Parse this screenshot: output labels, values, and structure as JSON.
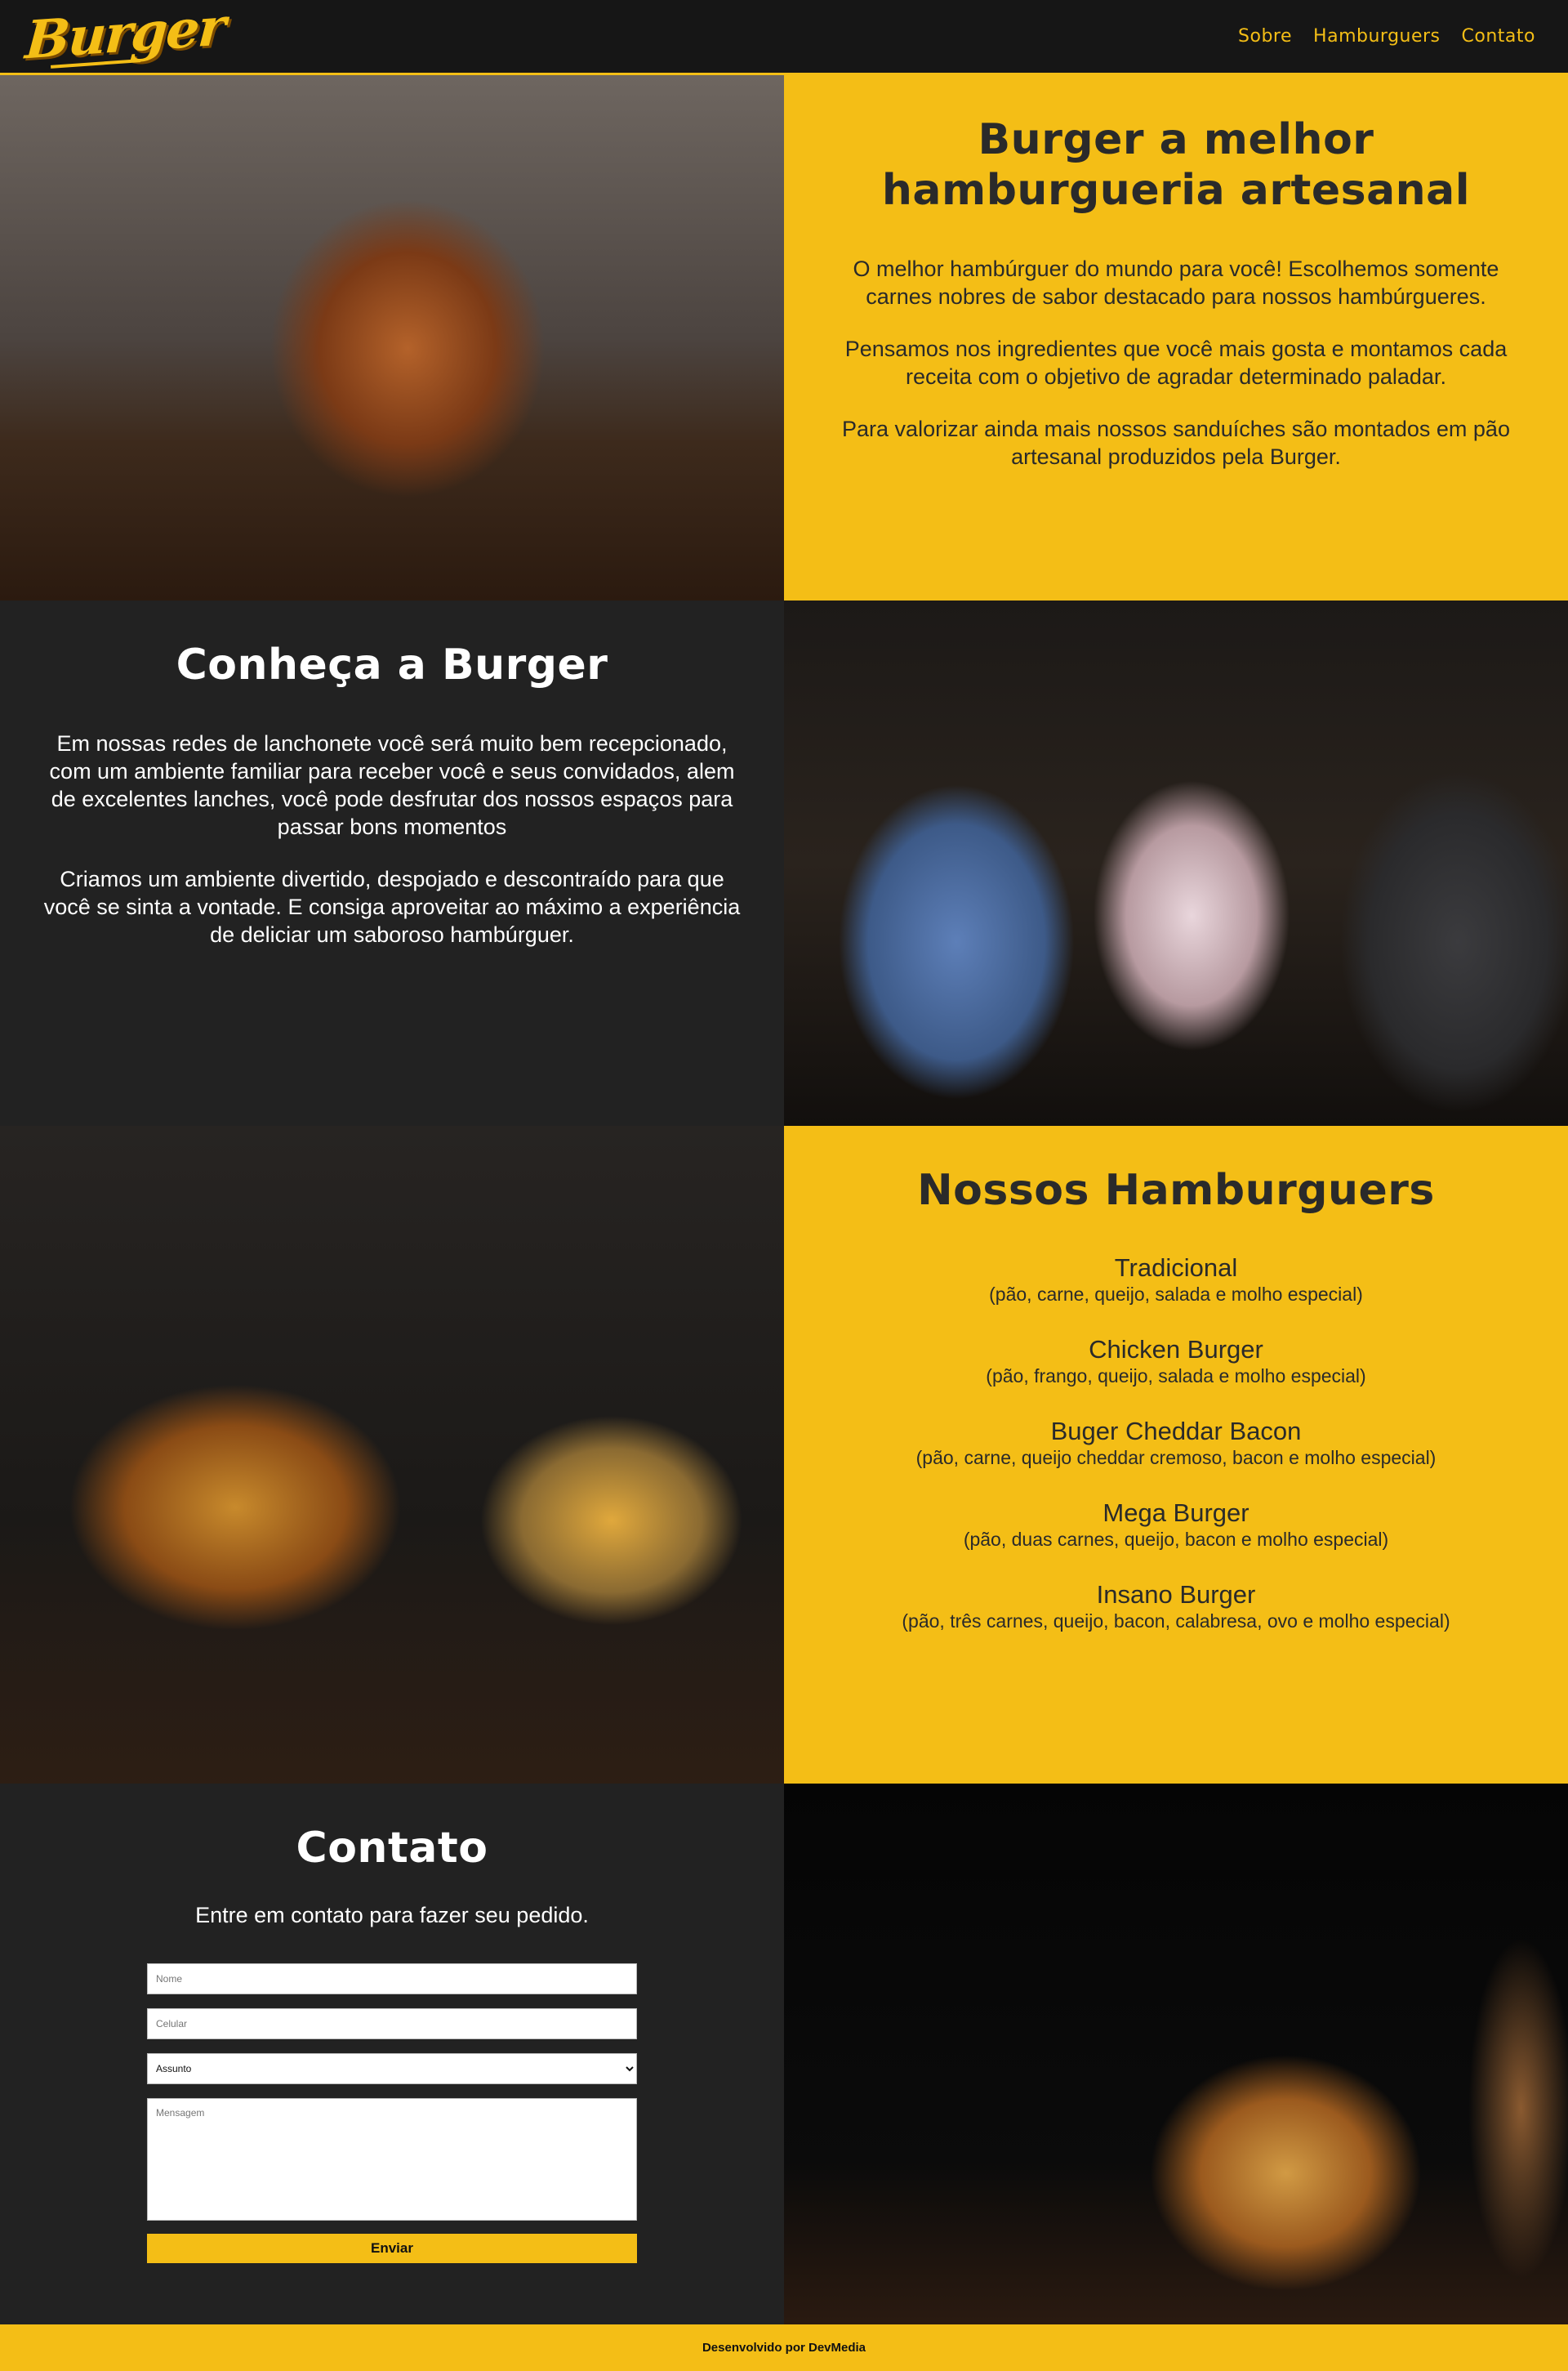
{
  "header": {
    "logo": "Burger",
    "nav": [
      "Sobre",
      "Hamburguers",
      "Contato"
    ]
  },
  "about": {
    "title": "Burger a melhor hamburgueria artesanal",
    "paragraphs": [
      "O melhor hambúrguer do mundo para você! Escolhemos somente carnes nobres de sabor destacado para nossos hambúrgueres.",
      "Pensamos nos ingredientes que você mais gosta e montamos cada receita com o objetivo de agradar determinado paladar.",
      "Para valorizar ainda mais nossos sanduíches são montados em pão artesanal produzidos pela Burger."
    ]
  },
  "know": {
    "title": "Conheça a Burger",
    "paragraphs": [
      "Em nossas redes de lanchonete você será muito bem recepcionado, com um ambiente familiar para receber você e seus convidados, alem de excelentes lanches, você pode desfrutar dos nossos espaços para passar bons momentos",
      "Criamos um ambiente divertido, despojado e descontraído para que você se sinta a vontade. E consiga aproveitar ao máximo a experiência de deliciar um saboroso hambúrguer."
    ]
  },
  "menu": {
    "title": "Nossos Hamburguers",
    "items": [
      {
        "name": "Tradicional",
        "desc": "(pão, carne, queijo, salada e molho especial)"
      },
      {
        "name": "Chicken Burger",
        "desc": "(pão, frango, queijo, salada e molho especial)"
      },
      {
        "name": "Buger Cheddar Bacon",
        "desc": "(pão, carne, queijo cheddar cremoso, bacon e molho especial)"
      },
      {
        "name": "Mega Burger",
        "desc": "(pão, duas carnes, queijo, bacon e molho especial)"
      },
      {
        "name": "Insano Burger",
        "desc": "(pão, três carnes, queijo, bacon, calabresa, ovo e molho especial)"
      }
    ]
  },
  "contact": {
    "title": "Contato",
    "subtitle": "Entre em contato para fazer seu pedido.",
    "name_placeholder": "Nome",
    "phone_placeholder": "Celular",
    "subject_selected": "Assunto",
    "message_placeholder": "Mensagem",
    "submit_label": "Enviar"
  },
  "footer": {
    "text": "Desenvolvido por DevMedia"
  },
  "colors": {
    "accent": "#f4be16",
    "dark": "#222222",
    "header": "#161616"
  }
}
